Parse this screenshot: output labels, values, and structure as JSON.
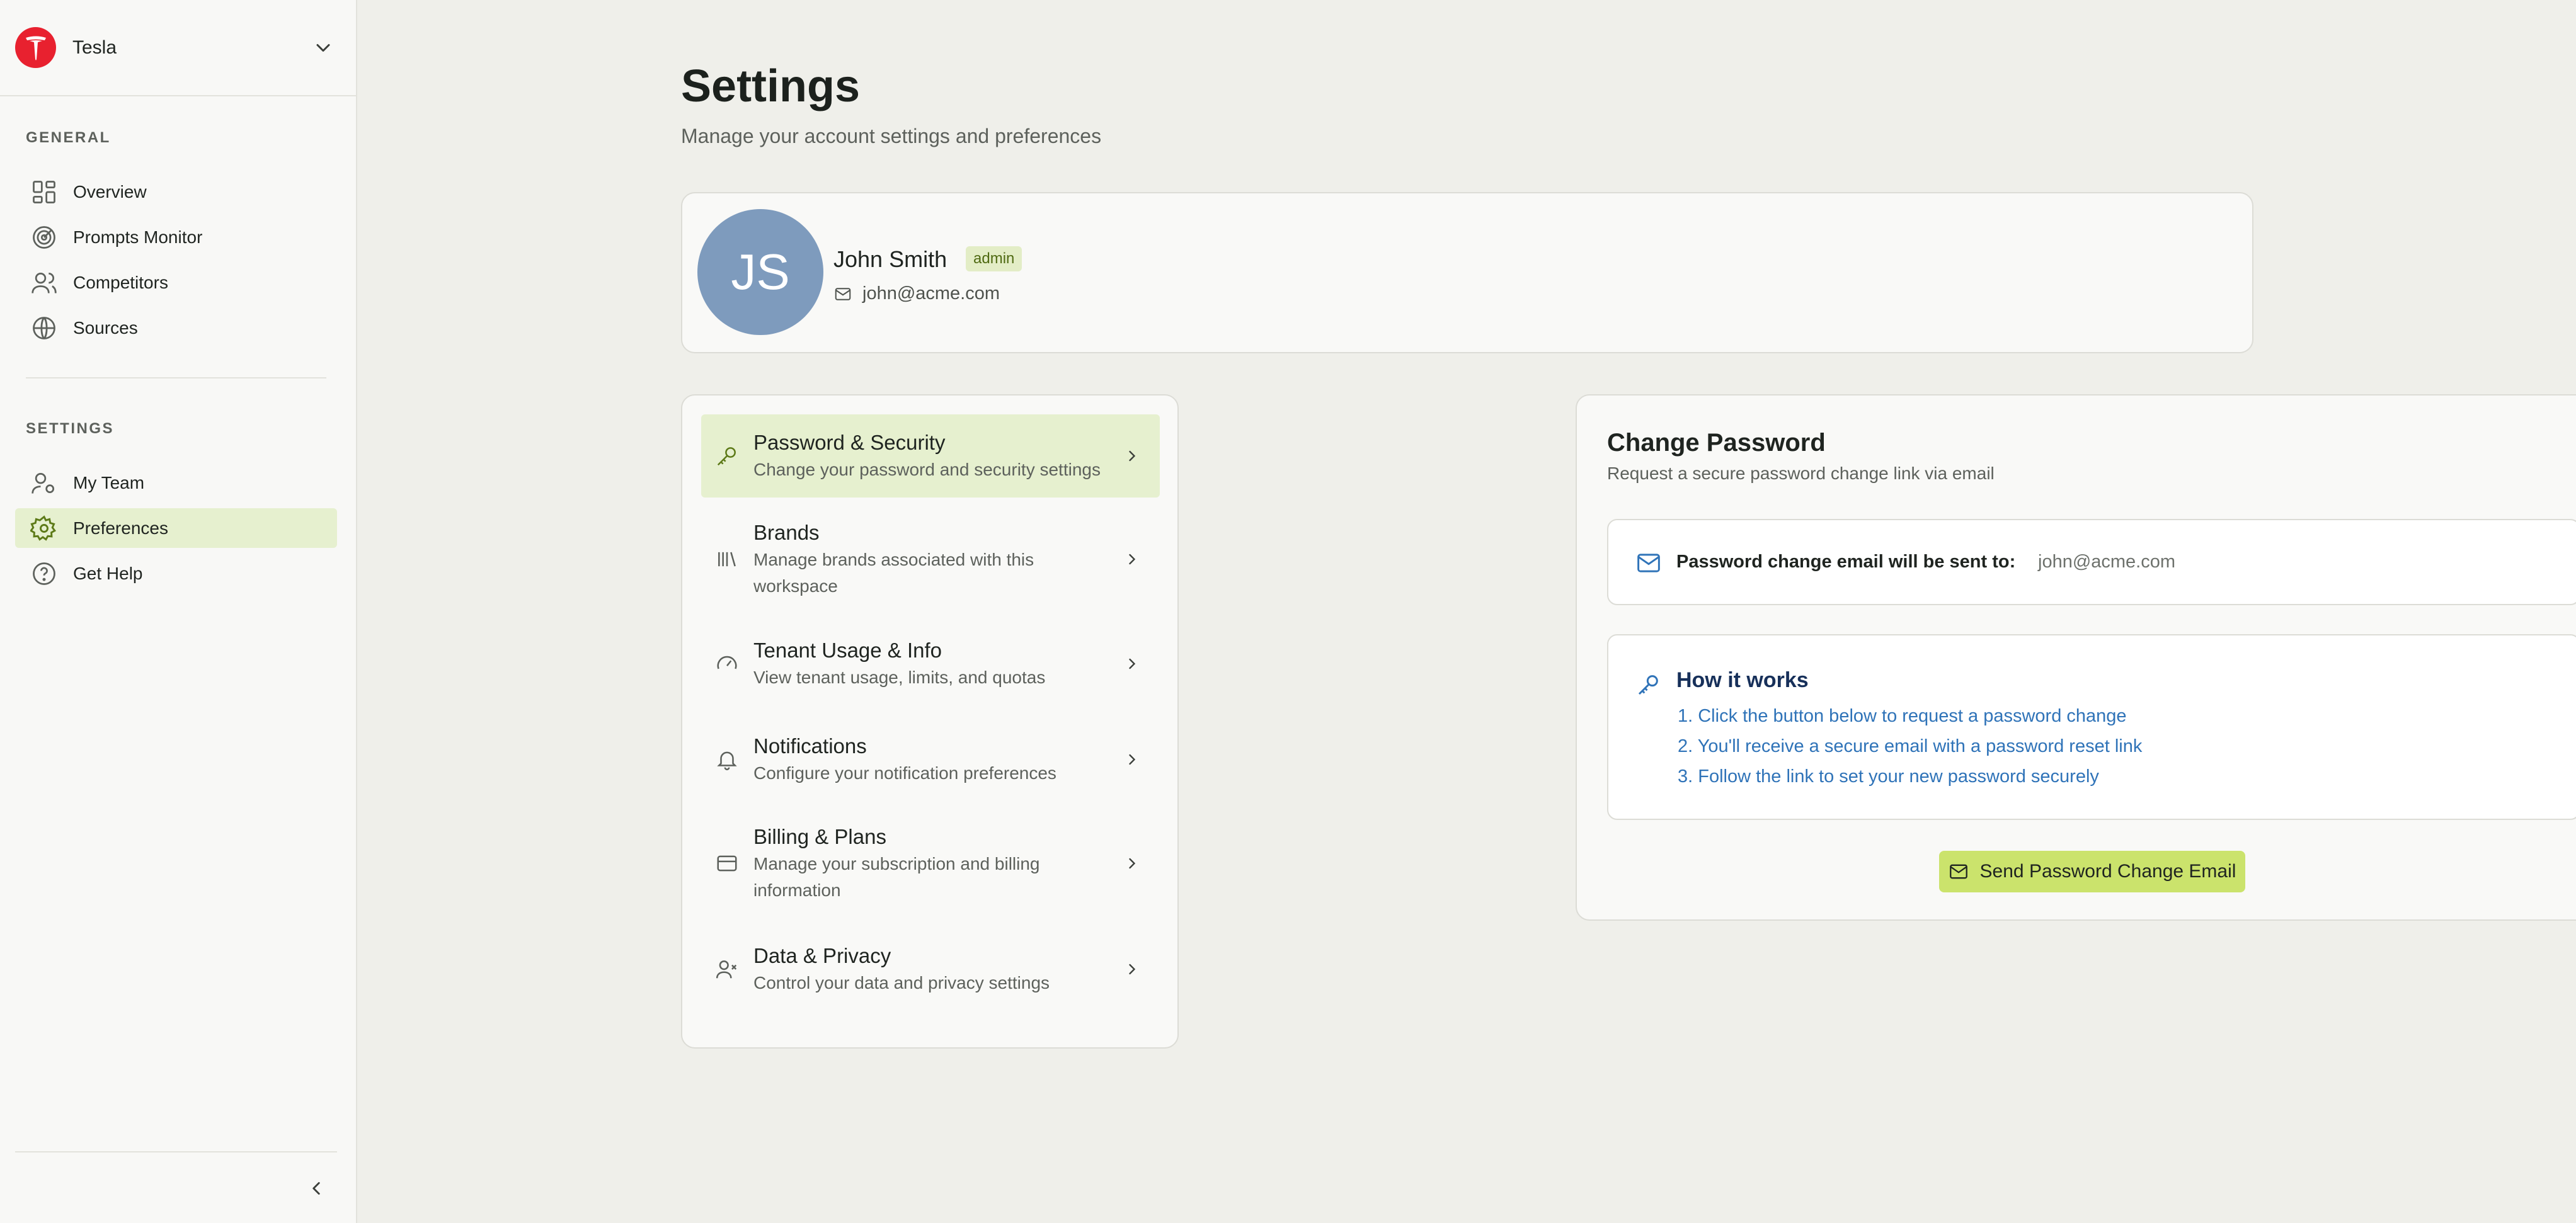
{
  "workspace": {
    "name": "Tesla"
  },
  "sidebar": {
    "general_heading": "GENERAL",
    "general_items": [
      {
        "label": "Overview",
        "icon": "grid-icon"
      },
      {
        "label": "Prompts Monitor",
        "icon": "radar-icon"
      },
      {
        "label": "Competitors",
        "icon": "users-icon"
      },
      {
        "label": "Sources",
        "icon": "globe-icon"
      }
    ],
    "settings_heading": "SETTINGS",
    "settings_items": [
      {
        "label": "My Team",
        "icon": "user-gear-icon"
      },
      {
        "label": "Preferences",
        "icon": "gear-icon",
        "active": true
      },
      {
        "label": "Get Help",
        "icon": "help-circle-icon"
      }
    ]
  },
  "page": {
    "title": "Settings",
    "subtitle": "Manage your account settings and preferences"
  },
  "profile": {
    "initials": "JS",
    "name": "John Smith",
    "role": "admin",
    "email": "john@acme.com"
  },
  "menu": [
    {
      "title": "Password & Security",
      "desc": "Change your password and security settings",
      "icon": "key-icon",
      "active": true
    },
    {
      "title": "Brands",
      "desc": "Manage brands associated with this workspace",
      "icon": "library-icon"
    },
    {
      "title": "Tenant Usage & Info",
      "desc": "View tenant usage, limits, and quotas",
      "icon": "gauge-icon"
    },
    {
      "title": "Notifications",
      "desc": "Configure your notification preferences",
      "icon": "bell-icon"
    },
    {
      "title": "Billing & Plans",
      "desc": "Manage your subscription and billing information",
      "icon": "credit-card-icon"
    },
    {
      "title": "Data & Privacy",
      "desc": "Control your data and privacy settings",
      "icon": "user-x-icon"
    }
  ],
  "change_password": {
    "title": "Change Password",
    "subtitle": "Request a secure password change link via email",
    "email_label": "Password change email will be sent to:",
    "email_value": "john@acme.com",
    "how_title": "How it works",
    "steps": [
      "1. Click the button below to request a password change",
      "2. You'll receive a secure email with a password reset link",
      "3. Follow the link to set your new password securely"
    ],
    "button_label": "Send Password Change Email"
  },
  "colors": {
    "accent_active": "#e6f0cf",
    "button": "#cbe36c",
    "brand_red": "#e8212f",
    "avatar": "#7e9bbd",
    "step_blue": "#2f73b8"
  }
}
